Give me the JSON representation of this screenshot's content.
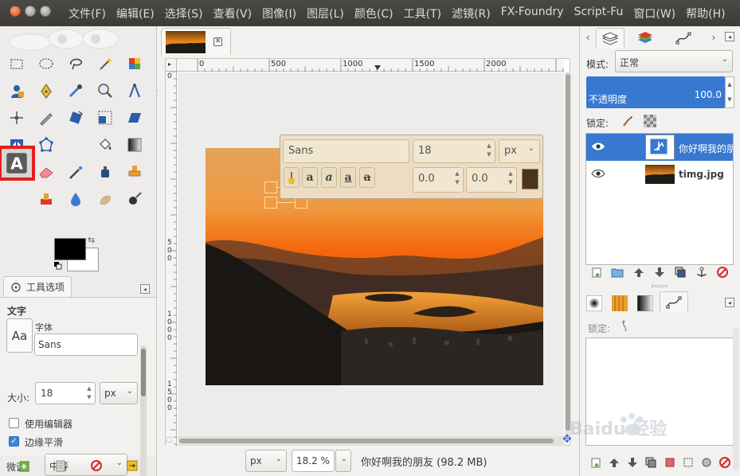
{
  "menubar": {
    "items": [
      "文件(F)",
      "编辑(E)",
      "选择(S)",
      "查看(V)",
      "图像(I)",
      "图层(L)",
      "颜色(C)",
      "工具(T)",
      "滤镜(R)",
      "FX-Foundry",
      "Script-Fu",
      "窗口(W)",
      "帮助(H)"
    ]
  },
  "toolbox": {
    "active_tool": "text-tool",
    "foreground_color": "#000000",
    "background_color": "#ffffff"
  },
  "tool_options": {
    "tab_label": "工具选项",
    "section_title": "文字",
    "font_preview": "Aa",
    "font_label": "字体",
    "font_value": "Sans",
    "size_label": "大小:",
    "size_value": "18",
    "size_unit": "px",
    "use_editor_label": "使用编辑器",
    "use_editor_checked": false,
    "antialias_label": "边缘平滑",
    "antialias_checked": true,
    "hinting_label": "微调:",
    "hinting_value": "中等"
  },
  "image_window": {
    "ruler_h_labels": [
      "0",
      "500",
      "1000",
      "1500",
      "2000"
    ],
    "ruler_v_labels": [
      "5 0 0",
      "1 0 0 0",
      "1 5 0 0"
    ],
    "text_overlay": {
      "font": "Sans",
      "size": "18",
      "unit": "px",
      "baseline": "0.0",
      "kerning": "0.0",
      "color": "#4b3418"
    },
    "status": {
      "unit": "px",
      "zoom": "18.2 %",
      "info": "你好啊我的朋友 (98.2 MB)"
    }
  },
  "layers_dock": {
    "mode_label": "模式:",
    "mode_value": "正常",
    "opacity_label": "不透明度",
    "opacity_value": "100.0",
    "lock_label": "锁定:",
    "layers": [
      {
        "name": "你好啊我的朋友",
        "type": "text",
        "selected": true,
        "visible": true
      },
      {
        "name": "timg.jpg",
        "type": "image",
        "selected": false,
        "visible": true
      }
    ]
  },
  "paths_dock": {
    "lock_label": "锁定:"
  },
  "watermark": {
    "text": "Baidu 经验"
  }
}
